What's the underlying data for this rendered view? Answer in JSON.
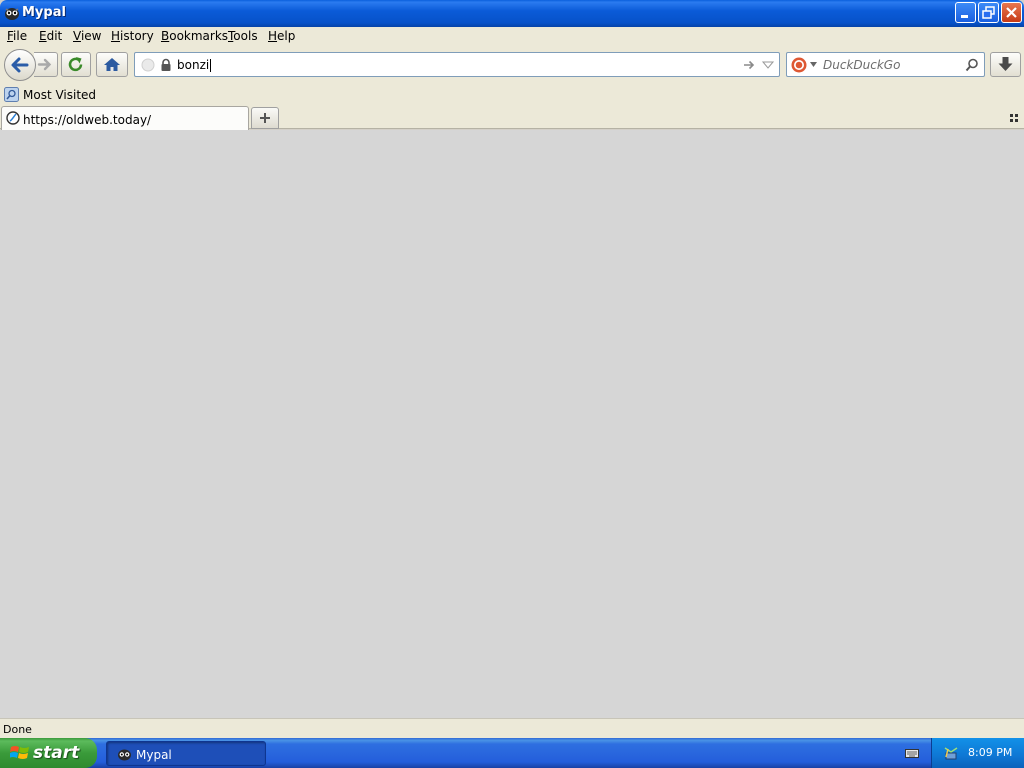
{
  "window": {
    "title": "Mypal"
  },
  "menu": {
    "items": [
      {
        "label": "File",
        "accel": "F",
        "rest": "ile"
      },
      {
        "label": "Edit",
        "accel": "E",
        "rest": "dit"
      },
      {
        "label": "View",
        "accel": "V",
        "rest": "iew"
      },
      {
        "label": "History",
        "accel": "H",
        "rest": "istory"
      },
      {
        "label": "Bookmarks",
        "accel": "B",
        "rest": "ookmarks"
      },
      {
        "label": "Tools",
        "accel": "T",
        "rest": "ools"
      },
      {
        "label": "Help",
        "accel": "H",
        "rest": "elp"
      }
    ]
  },
  "navbar": {
    "url_value": "bonzi",
    "search_placeholder": "DuckDuckGo"
  },
  "bookmarks": {
    "most_visited": "Most Visited"
  },
  "tabs": [
    {
      "label": "https://oldweb.today/"
    }
  ],
  "status": {
    "text": "Done"
  },
  "taskbar": {
    "start_label": "start",
    "task_label": "Mypal",
    "clock": "8:09 PM"
  },
  "colors": {
    "chrome": "#ece9d8",
    "content": "#d6d6d6",
    "xp_blue": "#245edb",
    "start_green": "#3a9b3a"
  }
}
